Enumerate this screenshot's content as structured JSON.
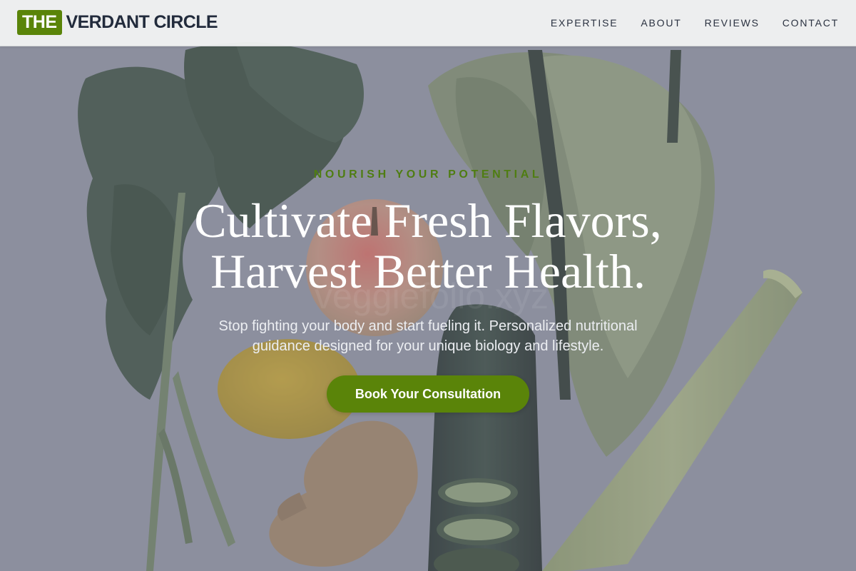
{
  "brand": {
    "badge": "THE",
    "name": "VERDANT CIRCLE",
    "accent_color": "#5a8409"
  },
  "nav": {
    "links": [
      "EXPERTISE",
      "ABOUT",
      "REVIEWS",
      "CONTACT"
    ]
  },
  "hero": {
    "eyebrow": "NOURISH YOUR POTENTIAL",
    "headline_line1": "Cultivate Fresh Flavors,",
    "headline_line2": "Harvest Better Health.",
    "subtext": "Stop fighting your body and start fueling it. Personalized nutritional guidance designed for your unique biology and lifestyle.",
    "cta_label": "Book Your Consultation",
    "background_image": "vegetables-flatlay-image",
    "watermark": "veggiefolio.xyz"
  }
}
